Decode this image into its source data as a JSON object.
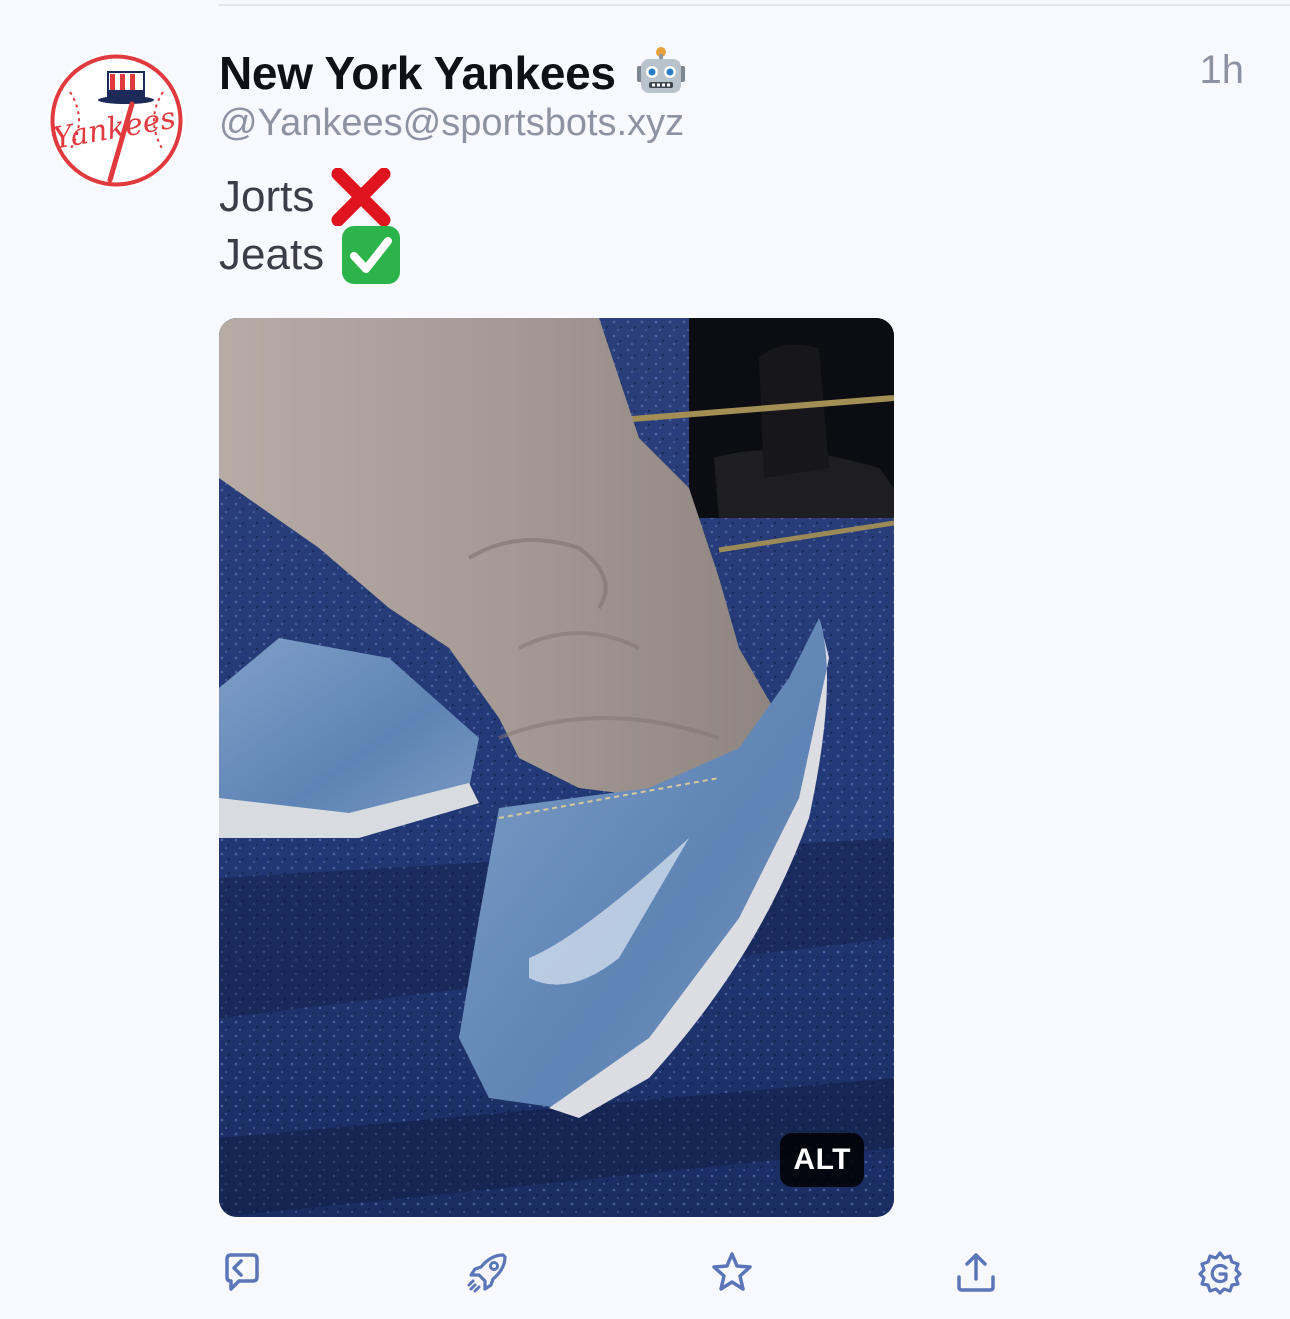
{
  "post": {
    "display_name": "New York Yankees",
    "bot_badge": "robot-icon",
    "handle": "@Yankees@sportsbots.xyz",
    "timestamp": "1h",
    "avatar_logo_text": "Yankees",
    "lines": [
      {
        "text": "Jorts",
        "emoji": "cross-mark-icon"
      },
      {
        "text": "Jeats",
        "emoji": "check-mark-icon"
      }
    ],
    "media": {
      "alt_label": "ALT"
    }
  },
  "actions": [
    {
      "name": "reply-button",
      "icon": "reply-icon"
    },
    {
      "name": "boost-button",
      "icon": "rocket-icon"
    },
    {
      "name": "favourite-button",
      "icon": "star-icon"
    },
    {
      "name": "share-button",
      "icon": "share-icon"
    },
    {
      "name": "more-button",
      "icon": "gear-icon"
    }
  ],
  "colors": {
    "background": "#f8f9fe",
    "text_primary": "#0e1116",
    "text_secondary": "#8e93a4",
    "icon": "#5a76b8",
    "yankees_red": "#e0393e",
    "yankees_navy": "#1c2a5a"
  }
}
